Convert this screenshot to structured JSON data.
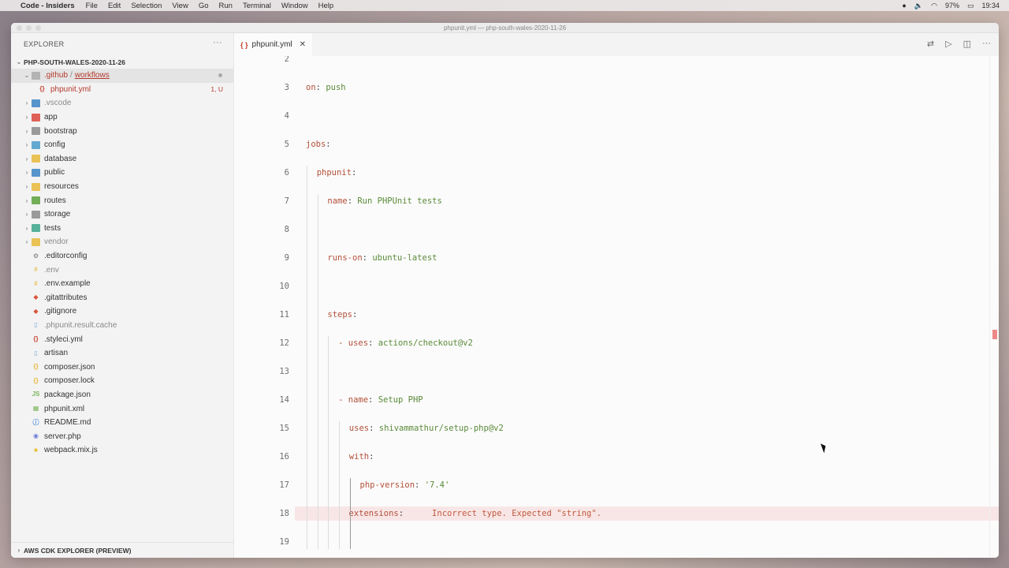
{
  "menubar": {
    "app_name": "Code - Insiders",
    "items": [
      "File",
      "Edit",
      "Selection",
      "View",
      "Go",
      "Run",
      "Terminal",
      "Window",
      "Help"
    ],
    "battery": "97%",
    "time": "19:34"
  },
  "window": {
    "title": "phpunit.yml — php-south-wales-2020-11-26"
  },
  "sidebar": {
    "header": "EXPLORER",
    "more": "···",
    "project": "PHP-SOUTH-WALES-2020-11-26",
    "footer": "AWS CDK EXPLORER (PREVIEW)",
    "github_folder": ".github",
    "github_sep": "/",
    "github_sub": "workflows",
    "phpunit_yml": "phpunit.yml",
    "phpunit_yml_badge": "1, U",
    "items": [
      {
        "label": ".vscode",
        "kind": "folder",
        "color": "#3b82c4",
        "dim": true
      },
      {
        "label": "app",
        "kind": "folder",
        "color": "#d9453a",
        "dim": false
      },
      {
        "label": "bootstrap",
        "kind": "folder",
        "color": "#8a8a8a",
        "dim": false
      },
      {
        "label": "config",
        "kind": "folder",
        "color": "#4a9bc9",
        "dim": false
      },
      {
        "label": "database",
        "kind": "folder",
        "color": "#e8b83a",
        "dim": false
      },
      {
        "label": "public",
        "kind": "folder",
        "color": "#3b82c4",
        "dim": false
      },
      {
        "label": "resources",
        "kind": "folder",
        "color": "#e8b83a",
        "dim": false
      },
      {
        "label": "routes",
        "kind": "folder",
        "color": "#5aa13a",
        "dim": false
      },
      {
        "label": "storage",
        "kind": "folder",
        "color": "#8a8a8a",
        "dim": false
      },
      {
        "label": "tests",
        "kind": "folder",
        "color": "#3aa58a",
        "dim": false
      },
      {
        "label": "vendor",
        "kind": "folder",
        "color": "#e8b83a",
        "dim": true
      },
      {
        "label": ".editorconfig",
        "kind": "file",
        "glyph": "⚙",
        "color": "#777",
        "dim": false
      },
      {
        "label": ".env",
        "kind": "file",
        "glyph": "#",
        "color": "#e8c25a",
        "dim": true
      },
      {
        "label": ".env.example",
        "kind": "file",
        "glyph": "#",
        "color": "#e8c25a",
        "dim": false
      },
      {
        "label": ".gitattributes",
        "kind": "file",
        "glyph": "◆",
        "color": "#d9533a",
        "dim": false
      },
      {
        "label": ".gitignore",
        "kind": "file",
        "glyph": "◆",
        "color": "#d9533a",
        "dim": false
      },
      {
        "label": ".phpunit.result.cache",
        "kind": "file",
        "glyph": "▯",
        "color": "#7aa7d8",
        "dim": true
      },
      {
        "label": ".styleci.yml",
        "kind": "file",
        "glyph": "{}",
        "color": "#c2402e",
        "dim": false
      },
      {
        "label": "artisan",
        "kind": "file",
        "glyph": "▯",
        "color": "#7aa7d8",
        "dim": false
      },
      {
        "label": "composer.json",
        "kind": "file",
        "glyph": "{}",
        "color": "#e8b83a",
        "dim": false
      },
      {
        "label": "composer.lock",
        "kind": "file",
        "glyph": "{}",
        "color": "#e8b83a",
        "dim": false
      },
      {
        "label": "package.json",
        "kind": "file",
        "glyph": "JS",
        "color": "#7ab55c",
        "dim": false
      },
      {
        "label": "phpunit.xml",
        "kind": "file",
        "glyph": "▦",
        "color": "#7ab55c",
        "dim": false
      },
      {
        "label": "README.md",
        "kind": "file",
        "glyph": "ⓘ",
        "color": "#4a8ad8",
        "dim": false
      },
      {
        "label": "server.php",
        "kind": "file",
        "glyph": "◉",
        "color": "#6a7fd8",
        "dim": false
      },
      {
        "label": "webpack.mix.js",
        "kind": "file",
        "glyph": "■",
        "color": "#e8c23a",
        "dim": false
      }
    ]
  },
  "editor": {
    "tab_icon": "{ }",
    "tab_label": "phpunit.yml",
    "tab_close": "✕",
    "lines": [
      {
        "n": "2",
        "indent": 0,
        "key": "",
        "sep": "",
        "val": ""
      },
      {
        "n": "3",
        "indent": 0,
        "key": "on",
        "sep": ": ",
        "val": "push"
      },
      {
        "n": "4",
        "indent": 0,
        "key": "",
        "sep": "",
        "val": ""
      },
      {
        "n": "5",
        "indent": 0,
        "key": "jobs",
        "sep": ":",
        "val": ""
      },
      {
        "n": "6",
        "indent": 1,
        "key": "phpunit",
        "sep": ":",
        "val": ""
      },
      {
        "n": "7",
        "indent": 2,
        "key": "name",
        "sep": ": ",
        "val": "Run PHPUnit tests"
      },
      {
        "n": "8",
        "indent": 0,
        "key": "",
        "sep": "",
        "val": ""
      },
      {
        "n": "9",
        "indent": 2,
        "key": "runs-on",
        "sep": ": ",
        "val": "ubuntu-latest"
      },
      {
        "n": "10",
        "indent": 0,
        "key": "",
        "sep": "",
        "val": ""
      },
      {
        "n": "11",
        "indent": 2,
        "key": "steps",
        "sep": ":",
        "val": ""
      },
      {
        "n": "12",
        "indent": 3,
        "dash": "- ",
        "key": "uses",
        "sep": ": ",
        "val": "actions/checkout@v2"
      },
      {
        "n": "13",
        "indent": 0,
        "key": "",
        "sep": "",
        "val": ""
      },
      {
        "n": "14",
        "indent": 3,
        "dash": "- ",
        "key": "name",
        "sep": ": ",
        "val": "Setup PHP"
      },
      {
        "n": "15",
        "indent": 4,
        "key": "uses",
        "sep": ": ",
        "val": "shivammathur/setup-php@v2"
      },
      {
        "n": "16",
        "indent": 4,
        "key": "with",
        "sep": ":",
        "val": ""
      },
      {
        "n": "17",
        "indent": 5,
        "key": "php-version",
        "sep": ": ",
        "val": "'7.4'"
      },
      {
        "n": "18",
        "indent": 5,
        "key": "extensions",
        "sep": ":",
        "val": "",
        "error": "Incorrect type. Expected \"string\"."
      },
      {
        "n": "19",
        "indent": 0,
        "key": "",
        "sep": "",
        "val": ""
      }
    ]
  }
}
